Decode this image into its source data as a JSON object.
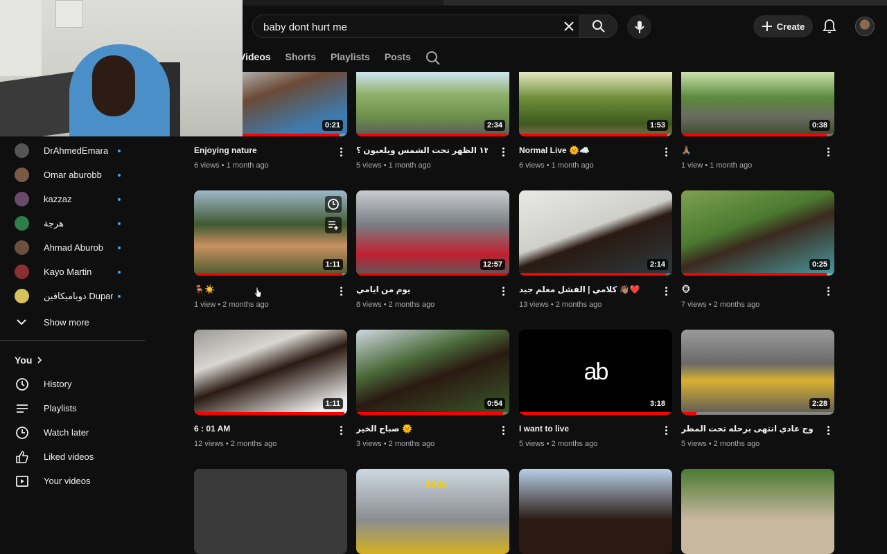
{
  "header": {
    "search_value": "baby dont hurt me",
    "create_label": "Create"
  },
  "channel_tabs": [
    {
      "label": "Videos",
      "active": true
    },
    {
      "label": "Shorts",
      "active": false
    },
    {
      "label": "Playlists",
      "active": false
    },
    {
      "label": "Posts",
      "active": false
    }
  ],
  "sidebar": {
    "subscriptions": [
      {
        "name": "DrAhmedEmara",
        "color": "#555"
      },
      {
        "name": "Omar aburobb",
        "color": "#7a5a44"
      },
      {
        "name": "kazzaz",
        "color": "#6a4a6a"
      },
      {
        "name": "هرجة",
        "color": "#2e7d4a"
      },
      {
        "name": "Ahmad Aburob",
        "color": "#6b5040"
      },
      {
        "name": "Kayo Martin",
        "color": "#8a3030"
      },
      {
        "name": "دوباميكافين Dupami...",
        "color": "#d6c25a"
      }
    ],
    "show_more": "Show more",
    "you_label": "You",
    "you_items": [
      {
        "label": "History",
        "icon": "history-icon"
      },
      {
        "label": "Playlists",
        "icon": "playlists-icon"
      },
      {
        "label": "Watch later",
        "icon": "watch-later-icon"
      },
      {
        "label": "Liked videos",
        "icon": "like-icon"
      },
      {
        "label": "Your videos",
        "icon": "your-videos-icon"
      }
    ]
  },
  "videos": [
    {
      "title": "Enjoying nature",
      "meta": "6 views • 1 month ago",
      "duration": "0:21",
      "progress": 0.95,
      "thumb": "linear-gradient(160deg,#d9e6ee 0%,#6b4a36 40%,#3d7cb0 80%)"
    },
    {
      "title": "الساعه ١٢ الظهر تحت الشمس ويلعبون ؟",
      "meta": "5 views • 1 month ago",
      "duration": "2:34",
      "progress": 0.98,
      "thumb": "linear-gradient(180deg,#cfe4f2 0%,#8fb06a 35%,#6b8f4a 70%,#5a5a5a 100%)"
    },
    {
      "title": "Normal Live 🌞☁️",
      "meta": "6 views • 1 month ago",
      "duration": "1:53",
      "progress": 0.97,
      "thumb": "linear-gradient(180deg,#e6e8c0 0%,#6f8f3a 40%,#3f5a20 80%,#7a6a4a 100%)"
    },
    {
      "title": "🙏🏽",
      "meta": "1 view • 1 month ago",
      "duration": "0:38",
      "progress": 0.95,
      "thumb": "linear-gradient(180deg,#cde0b0 0%,#5a8a3a 40%,#6a6a60 70%,#3a4a2a 100%)"
    },
    {
      "title": "🪑☀️",
      "meta": "1 view • 2 months ago",
      "duration": "1:11",
      "progress": 0.97,
      "thumb": "linear-gradient(180deg,#9fb8c8 0%,#3f5a30 40%,#c89060 65%,#4a5a30 100%)"
    },
    {
      "title": "يوم من ايامي",
      "meta": "8 views • 2 months ago",
      "duration": "12:57",
      "progress": 0.99,
      "thumb": "linear-gradient(180deg,#c8ccd0 0%,#7a7f84 40%,#c02030 75%,#5a5a5a 100%)"
    },
    {
      "title": "كلامي | الفشل معلم جيد 👋🏽❤️",
      "meta": "13 views • 2 months ago",
      "duration": "2:14",
      "progress": 0.96,
      "thumb": "linear-gradient(160deg,#e8e8e6 0%,#cfcfca 45%,#2a1a12 55%,#2c3a40 100%)"
    },
    {
      "title": "🐵",
      "meta": "7 views • 2 months ago",
      "duration": "0:25",
      "progress": 0.95,
      "thumb": "linear-gradient(160deg,#7fa050 0%,#4a7a30 40%,#3a2a1e 55%,#4a9aa0 100%)"
    },
    {
      "title": "6 : 01 AM",
      "meta": "12 views • 2 months ago",
      "duration": "1:11",
      "progress": 0.98,
      "thumb": "linear-gradient(160deg,#9a9a98 0%,#d8d6d0 30%,#2a1a12 50%,#f0f0f0 90%)"
    },
    {
      "title": "صباح الخير 🌞",
      "meta": "3 views • 2 months ago",
      "duration": "0:54",
      "progress": 0.96,
      "thumb": "linear-gradient(160deg,#cfd8e0 0%,#4a6a3a 35%,#2a1a12 55%,#3a5a2a 100%)"
    },
    {
      "title": "I want to live",
      "meta": "5 views • 2 months ago",
      "duration": "3:18",
      "progress": 0.98,
      "thumb": "#000000",
      "logo": "ab"
    },
    {
      "title": "خروج عادي انتهى برحله تحت المطر",
      "meta": "5 views • 2 months ago",
      "duration": "2:28",
      "progress": 0.1,
      "thumb": "linear-gradient(180deg,#9a9a9a 0%,#6a6a6a 40%,#d8b030 60%,#5a5a5a 100%)"
    },
    {
      "title": "",
      "meta": "",
      "duration": "",
      "progress": 0,
      "thumb": "#3a3a3a"
    },
    {
      "title": "",
      "meta": "",
      "duration": "",
      "progress": 0,
      "thumb": "linear-gradient(180deg,#cfd8e0 0%,#8a8e92 60%,#d4b020 100%)",
      "overlay": "100s"
    },
    {
      "title": "",
      "meta": "",
      "duration": "",
      "progress": 0,
      "thumb": "linear-gradient(180deg,#b8d0e8 0%,#2a1a12 60%)"
    },
    {
      "title": "",
      "meta": "",
      "duration": "",
      "progress": 0,
      "thumb": "linear-gradient(180deg,#4a7a30 0%,#c8b8a0 60%)"
    }
  ]
}
